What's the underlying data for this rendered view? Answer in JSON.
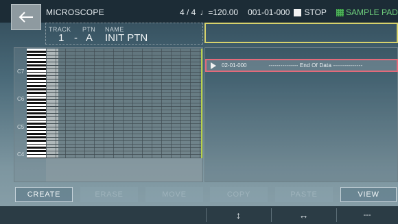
{
  "header": {
    "title": "MICROSCOPE",
    "time_signature": "4 / 4",
    "tempo": "♩=120.00",
    "position": "001-01-000",
    "transport_state": "STOP",
    "mode_label": "SAMPLE PAD"
  },
  "track_info": {
    "track_label": "TRACK",
    "track_value": "1",
    "dash": "-",
    "ptn_label": "PTN",
    "ptn_value": "A",
    "name_label": "NAME",
    "name_value": "INIT PTN"
  },
  "piano_roll": {
    "octave_labels": [
      "C7",
      "C6",
      "C5",
      "C4"
    ]
  },
  "event_list": {
    "rows": [
      {
        "position": "02-01-000",
        "event": "--------------- End Of Data ---------------"
      }
    ]
  },
  "buttons": {
    "create": "CREATE",
    "erase": "ERASE",
    "move": "MOVE",
    "copy": "COPY",
    "paste": "PASTE",
    "view": "VIEW"
  },
  "footer": {
    "vertical_zoom": "↕",
    "horizontal_zoom": "↔",
    "value": "---"
  },
  "colors": {
    "selection_highlight": "#d7d26c",
    "current_event_outline": "#e36a7a",
    "playhead": "#b7d24a",
    "sample_pad_accent": "#6fd07d"
  }
}
